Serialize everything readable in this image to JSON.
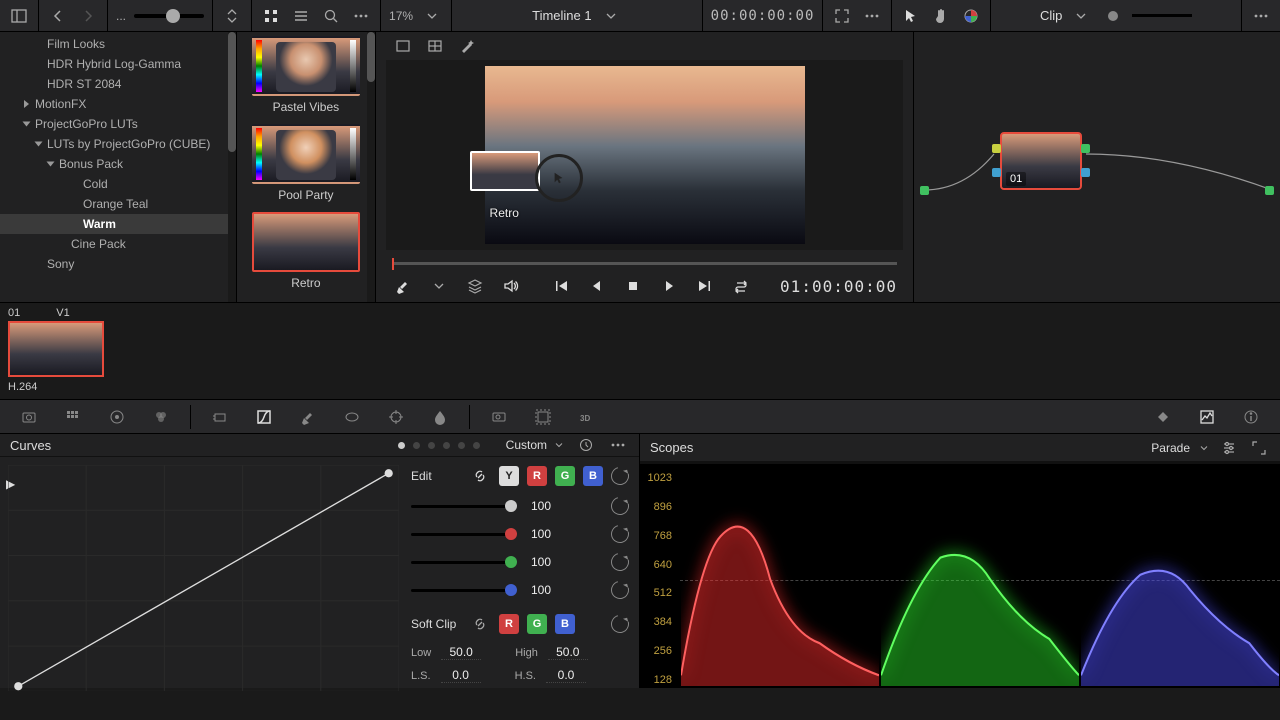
{
  "topbar": {
    "zoom": "17%",
    "timeline_name": "Timeline 1",
    "timecode": "00:00:00:00",
    "clip_label": "Clip"
  },
  "sidebar": {
    "items": [
      {
        "label": "Film Looks",
        "indent": 36
      },
      {
        "label": "HDR Hybrid Log-Gamma",
        "indent": 36
      },
      {
        "label": "HDR ST 2084",
        "indent": 36
      },
      {
        "label": "MotionFX",
        "indent": 24,
        "chev": true,
        "open": false
      },
      {
        "label": "ProjectGoPro LUTs",
        "indent": 24,
        "chev": true,
        "open": true
      },
      {
        "label": "LUTs by ProjectGoPro (CUBE)",
        "indent": 36,
        "chev": true,
        "open": true
      },
      {
        "label": "Bonus Pack",
        "indent": 48,
        "chev": true,
        "open": true
      },
      {
        "label": "Cold",
        "indent": 72
      },
      {
        "label": "Orange Teal",
        "indent": 72
      },
      {
        "label": "Warm",
        "indent": 72,
        "selected": true
      },
      {
        "label": "Cine Pack",
        "indent": 60
      },
      {
        "label": "Sony",
        "indent": 36
      }
    ]
  },
  "luts": [
    {
      "label": "Pastel Vibes",
      "face": "a"
    },
    {
      "label": "Pool Party",
      "face": "b"
    },
    {
      "label": "Retro",
      "selected": true
    }
  ],
  "viewer": {
    "drag_label": "Retro",
    "tc": "01:00:00:00"
  },
  "node": {
    "label": "01"
  },
  "clipstrip": {
    "num": "01",
    "track": "V1",
    "codec": "H.264"
  },
  "curves": {
    "title": "Curves",
    "mode": "Custom",
    "edit_label": "Edit",
    "softclip_label": "Soft Clip",
    "channels": {
      "y": "Y",
      "r": "R",
      "g": "G",
      "b": "B"
    },
    "rows": [
      {
        "value": "100",
        "color": "#cccccc"
      },
      {
        "value": "100",
        "color": "#d04040"
      },
      {
        "value": "100",
        "color": "#40b050"
      },
      {
        "value": "100",
        "color": "#4060d0"
      }
    ],
    "low_label": "Low",
    "low": "50.0",
    "high_label": "High",
    "high": "50.0",
    "ls_label": "L.S.",
    "ls": "0.0",
    "hs_label": "H.S.",
    "hs": "0.0"
  },
  "scopes": {
    "title": "Scopes",
    "mode": "Parade",
    "ticks": [
      "1023",
      "896",
      "768",
      "640",
      "512",
      "384",
      "256",
      "128"
    ]
  }
}
